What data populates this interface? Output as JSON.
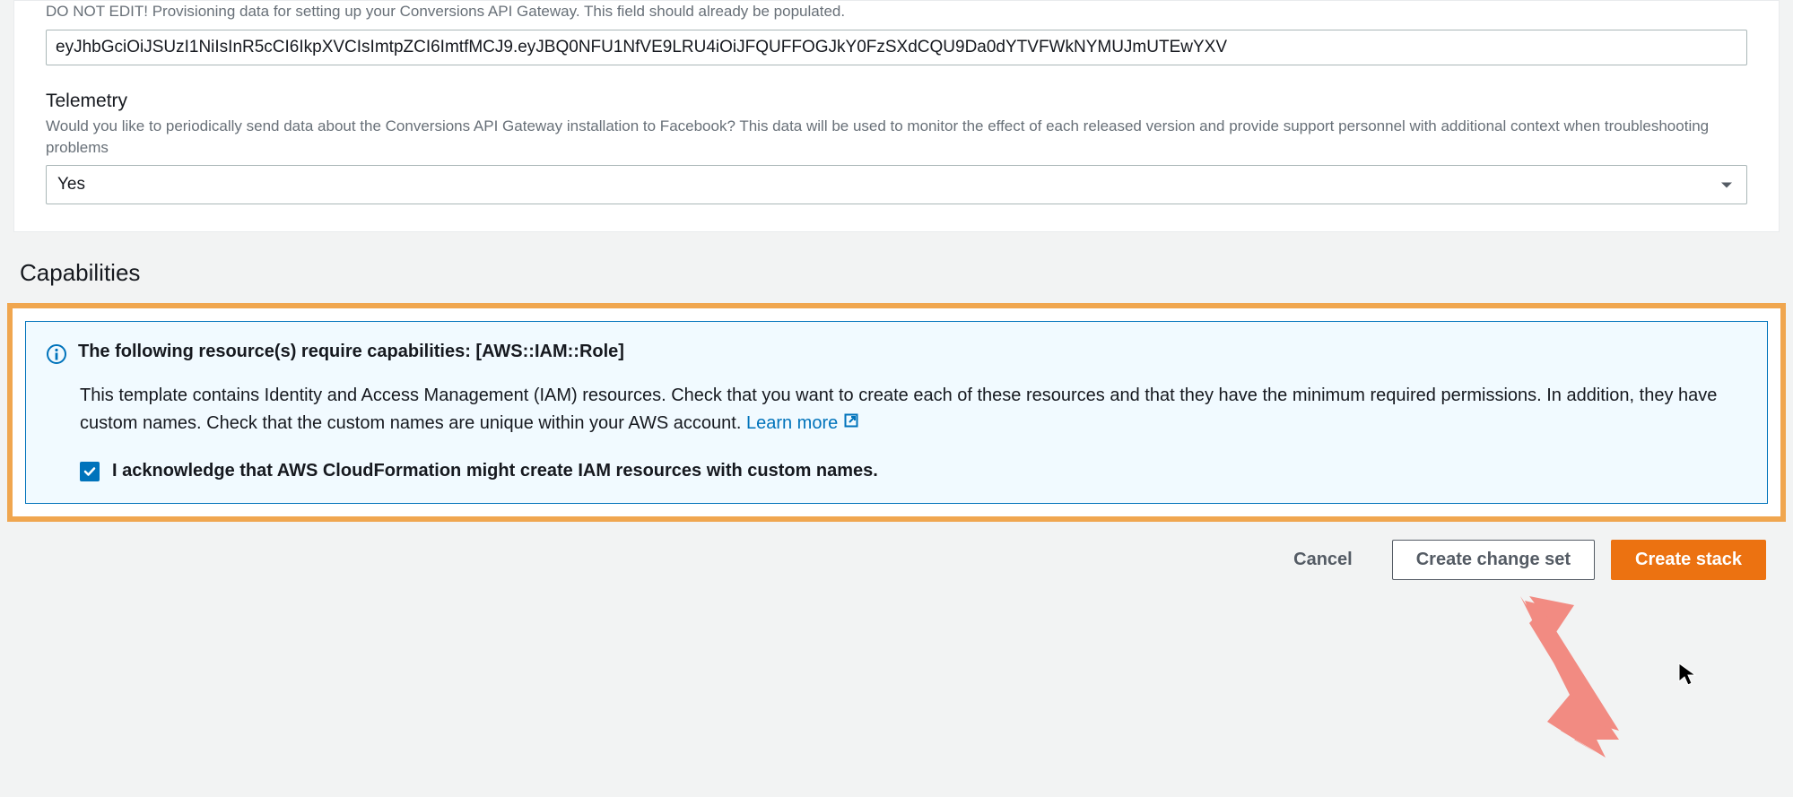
{
  "provisioning": {
    "help_text": "DO NOT EDIT! Provisioning data for setting up your Conversions API Gateway. This field should already be populated.",
    "value": "eyJhbGciOiJSUzI1NiIsInR5cCI6IkpXVCIsImtpZCI6ImtfMCJ9.eyJBQ0NFU1NfVE9LRU4iOiJFQUFFOGJkY0FzSXdCQU9Da0dYTVFWkNYMUJmUTEwYXV"
  },
  "telemetry": {
    "label": "Telemetry",
    "help_text": "Would you like to periodically send data about the Conversions API Gateway installation to Facebook? This data will be used to monitor the effect of each released version and provide support personnel with additional context when troubleshooting problems",
    "value": "Yes"
  },
  "capabilities": {
    "heading": "Capabilities",
    "info_title": "The following resource(s) require capabilities: [AWS::IAM::Role]",
    "info_body": "This template contains Identity and Access Management (IAM) resources. Check that you want to create each of these resources and that they have the minimum required permissions. In addition, they have custom names. Check that the custom names are unique within your AWS account. ",
    "learn_more": "Learn more",
    "ack_label": "I acknowledge that AWS CloudFormation might create IAM resources with custom names."
  },
  "footer": {
    "cancel": "Cancel",
    "create_change_set": "Create change set",
    "create_stack": "Create stack"
  }
}
